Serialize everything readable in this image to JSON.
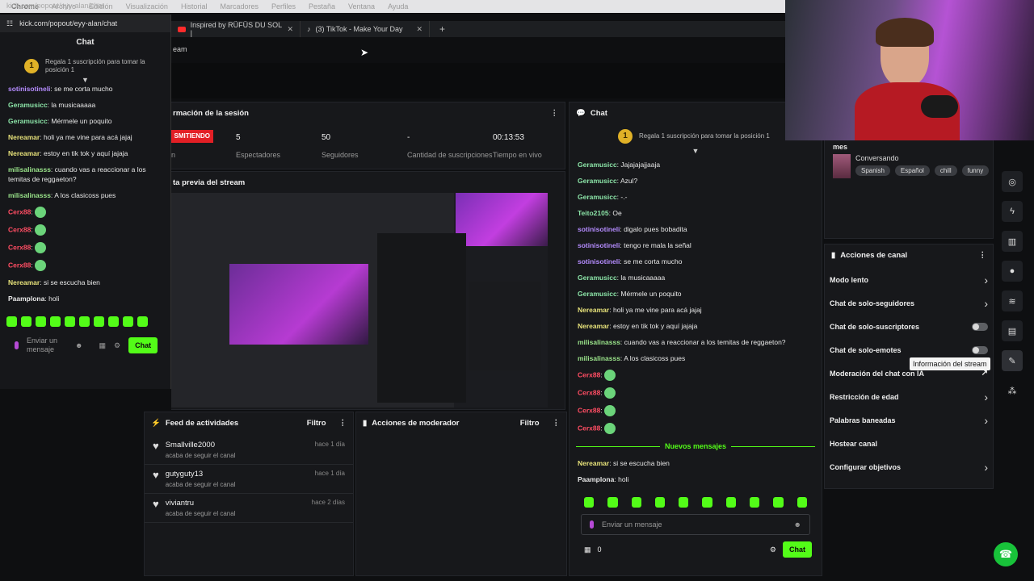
{
  "menubar": {
    "items": [
      "Chrome",
      "Archivo",
      "Edición",
      "Visualización",
      "Historial",
      "Marcadores",
      "Perfiles",
      "Pestaña",
      "Ventana",
      "Ayuda"
    ]
  },
  "browser": {
    "tabs": [
      {
        "label": "Inspired by RÜFÜS DU SOL |"
      },
      {
        "label": "(3) TikTok - Make Your Day"
      }
    ],
    "address_fragment": "eam",
    "colors": {
      "accent": "#53fc18"
    }
  },
  "popout": {
    "url": "kick.com/popout/eyy-alan/chat",
    "url_ghost": "kick.com/popout/eyy-alan/chat",
    "title": "Chat",
    "pinned_rank": "1",
    "pinned_text": "Regala 1 suscripción para tomar la posición 1",
    "messages": [
      {
        "user": "sotinisotineli",
        "text": "se me corta mucho",
        "color": "#b58cff"
      },
      {
        "user": "Geramusicc",
        "text": "la musicaaaaa",
        "color": "#8be3a7"
      },
      {
        "user": "Geramusicc",
        "text": "Mérmele un poquito",
        "color": "#8be3a7"
      },
      {
        "user": "Nereamar",
        "text": "holi ya me vine para acá jajaj",
        "color": "#e7e27a"
      },
      {
        "user": "Nereamar",
        "text": "estoy en tik tok y aquí jajaja",
        "color": "#e7e27a"
      },
      {
        "user": "milisalinasss",
        "text": "cuando vas a reaccionar a los temitas de reggaeton?",
        "color": "#9be58b"
      },
      {
        "user": "milisalinasss",
        "text": "A los clasicoss pues",
        "color": "#9be58b"
      },
      {
        "user": "Cerx88",
        "text": "",
        "color": "#ff4d63"
      },
      {
        "user": "Cerx88",
        "text": "",
        "color": "#ff4d63"
      },
      {
        "user": "Cerx88",
        "text": "",
        "color": "#ff4d63"
      },
      {
        "user": "Cerx88",
        "text": "",
        "color": "#ff4d63"
      },
      {
        "user": "Nereamar",
        "text": "si se escucha bien",
        "color": "#e7e27a"
      },
      {
        "user": "Paamplona",
        "text": "holi",
        "color": "#e8e8e8"
      }
    ],
    "input_placeholder": "Enviar un mensaje",
    "send_label": "Chat"
  },
  "session": {
    "title": "rmación de la sesión",
    "live_badge": "SMITIENDO",
    "live_sub": "n",
    "stats": [
      {
        "value": "5",
        "label": "Espectadores"
      },
      {
        "value": "50",
        "label": "Seguidores"
      },
      {
        "value": "-",
        "label": "Cantidad de suscripciones"
      },
      {
        "value": "00:13:53",
        "label": "Tiempo en vivo"
      }
    ]
  },
  "preview": {
    "title": "ta previa del stream"
  },
  "activity": {
    "title": "Feed de actividades",
    "filter": "Filtro",
    "items": [
      {
        "name": "Smallville2000",
        "sub": "acaba de seguir el canal",
        "time": "hace 1 día"
      },
      {
        "name": "gutyguty13",
        "sub": "acaba de seguir el canal",
        "time": "hace 1 día"
      },
      {
        "name": "viviantru",
        "sub": "acaba de seguir el canal",
        "time": "hace 2 días"
      }
    ]
  },
  "mod_actions": {
    "title": "Acciones de moderador",
    "filter": "Filtro"
  },
  "chat": {
    "title": "Chat",
    "pinned_rank": "1",
    "pinned_text": "Regala 1 suscripción para tomar la posición 1",
    "messages": [
      {
        "user": "Geramusicc",
        "text": "Jajajajajjaaja",
        "color": "#8be3a7"
      },
      {
        "user": "Geramusicc",
        "text": "Azul?",
        "color": "#8be3a7"
      },
      {
        "user": "Geramusicc",
        "text": "-.-",
        "color": "#8be3a7"
      },
      {
        "user": "Teito2105",
        "text": "Oe",
        "color": "#8be3a7"
      },
      {
        "user": "sotinisotineli",
        "text": "digalo pues bobadita",
        "color": "#b58cff"
      },
      {
        "user": "sotinisotineli",
        "text": "tengo re mala la señal",
        "color": "#b58cff"
      },
      {
        "user": "sotinisotineli",
        "text": "se me corta mucho",
        "color": "#b58cff"
      },
      {
        "user": "Geramusicc",
        "text": "la musicaaaaa",
        "color": "#8be3a7"
      },
      {
        "user": "Geramusicc",
        "text": "Mérmele un poquito",
        "color": "#8be3a7"
      },
      {
        "user": "Nereamar",
        "text": "holi ya me vine para acá jajaj",
        "color": "#e7e27a"
      },
      {
        "user": "Nereamar",
        "text": "estoy en tik tok y aquí jajaja",
        "color": "#e7e27a"
      },
      {
        "user": "milisalinasss",
        "text": "cuando vas a reaccionar a los temitas de reggaeton?",
        "color": "#9be58b"
      },
      {
        "user": "milisalinasss",
        "text": "A los clasicoss pues",
        "color": "#9be58b"
      },
      {
        "user": "Cerx88",
        "text": "",
        "color": "#ff4d63"
      },
      {
        "user": "Cerx88",
        "text": "",
        "color": "#ff4d63"
      },
      {
        "user": "Cerx88",
        "text": "",
        "color": "#ff4d63"
      },
      {
        "user": "Cerx88",
        "text": "",
        "color": "#ff4d63"
      }
    ],
    "new_messages": "Nuevos mensajes",
    "after_new": [
      {
        "user": "Nereamar",
        "text": "si se escucha bien",
        "color": "#e7e27a"
      },
      {
        "user": "Paamplona",
        "text": "holi",
        "color": "#e8e8e8"
      }
    ],
    "input_placeholder": "Enviar un mensaje",
    "count": "0",
    "send_label": "Chat"
  },
  "stream_info": {
    "category_fragment": "mes",
    "category": "Conversando",
    "tags": [
      "Spanish",
      "Español",
      "chill",
      "funny"
    ]
  },
  "channel_actions": {
    "title": "Acciones de canal",
    "items": [
      {
        "label": "Modo lento",
        "control": "chevron"
      },
      {
        "label": "Chat de solo-seguidores",
        "control": "chevron"
      },
      {
        "label": "Chat de solo-suscriptores",
        "control": "toggle"
      },
      {
        "label": "Chat de solo-emotes",
        "control": "toggle"
      },
      {
        "label": "Moderación del chat con IA",
        "control": "external"
      },
      {
        "label": "Restricción de edad",
        "control": "chevron"
      },
      {
        "label": "Palabras baneadas",
        "control": "chevron"
      },
      {
        "label": "Hostear canal",
        "control": "none"
      },
      {
        "label": "Configurar objetivos",
        "control": "chevron"
      }
    ]
  },
  "tooltip": "Información del stream"
}
